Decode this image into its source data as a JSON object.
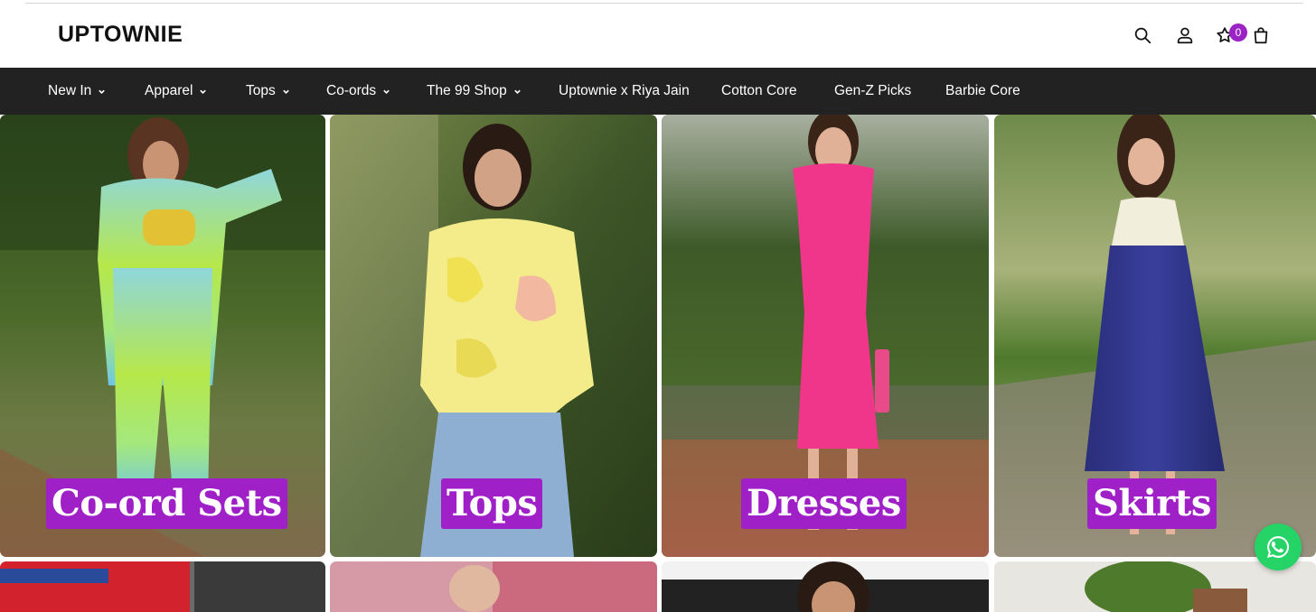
{
  "brand": {
    "name": "UPTOWNIE"
  },
  "header_icons": {
    "search": "search-icon",
    "account": "user-icon",
    "wishlist": "star-icon",
    "wishlist_count": "0",
    "cart": "bag-icon"
  },
  "nav": {
    "items": [
      {
        "label": "New In",
        "has_dropdown": true
      },
      {
        "label": "Apparel",
        "has_dropdown": true
      },
      {
        "label": "Tops",
        "has_dropdown": true
      },
      {
        "label": "Co-ords",
        "has_dropdown": true
      },
      {
        "label": "The 99 Shop",
        "has_dropdown": true
      },
      {
        "label": "Uptownie x Riya Jain",
        "has_dropdown": false
      },
      {
        "label": "Cotton Core",
        "has_dropdown": false
      },
      {
        "label": "Gen-Z Picks",
        "has_dropdown": false
      },
      {
        "label": "Barbie Core",
        "has_dropdown": false
      }
    ]
  },
  "categories": [
    {
      "label": "Co-ord Sets"
    },
    {
      "label": "Tops"
    },
    {
      "label": "Dresses"
    },
    {
      "label": "Skirts"
    }
  ],
  "floating": {
    "whatsapp": "whatsapp-icon"
  },
  "colors": {
    "accent": "#a020c8",
    "badge": "#9b22c4",
    "nav_bg": "#222222",
    "whatsapp": "#25d366"
  }
}
